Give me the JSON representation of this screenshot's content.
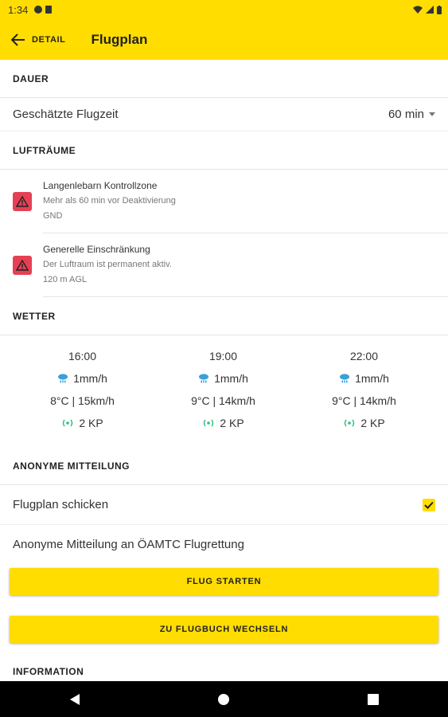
{
  "status": {
    "time": "1:34"
  },
  "appbar": {
    "back_label": "DETAIL",
    "title": "Flugplan"
  },
  "duration": {
    "header": "DAUER",
    "label": "Geschätzte Flugzeit",
    "value": "60 min"
  },
  "airspaces": {
    "header": "LUFTRÄUME",
    "items": [
      {
        "title": "Langenlebarn Kontrollzone",
        "line2": "Mehr als 60 min vor Deaktivierung",
        "line3": "GND"
      },
      {
        "title": "Generelle Einschränkung",
        "line2": "Der Luftraum ist permanent aktiv.",
        "line3": "120 m AGL"
      }
    ]
  },
  "weather": {
    "header": "WETTER",
    "slots": [
      {
        "time": "16:00",
        "rain": "1mm/h",
        "temp_wind": "8°C | 15km/h",
        "kp": "2 KP"
      },
      {
        "time": "19:00",
        "rain": "1mm/h",
        "temp_wind": "9°C | 14km/h",
        "kp": "2 KP"
      },
      {
        "time": "22:00",
        "rain": "1mm/h",
        "temp_wind": "9°C | 14km/h",
        "kp": "2 KP"
      }
    ]
  },
  "anon": {
    "header": "ANONYME MITTEILUNG",
    "send_label": "Flugplan schicken",
    "send_checked": true,
    "message_label": "Anonyme Mitteilung an ÖAMTC Flugrettung"
  },
  "buttons": {
    "start": "FLUG STARTEN",
    "logbook": "ZU FLUGBUCH WECHSELN"
  },
  "information": {
    "header": "INFORMATION"
  },
  "colors": {
    "accent": "#ffdd00",
    "warning": "#e64055",
    "rain_icon": "#3aa0d8",
    "kp_icon": "#2ec27e"
  }
}
